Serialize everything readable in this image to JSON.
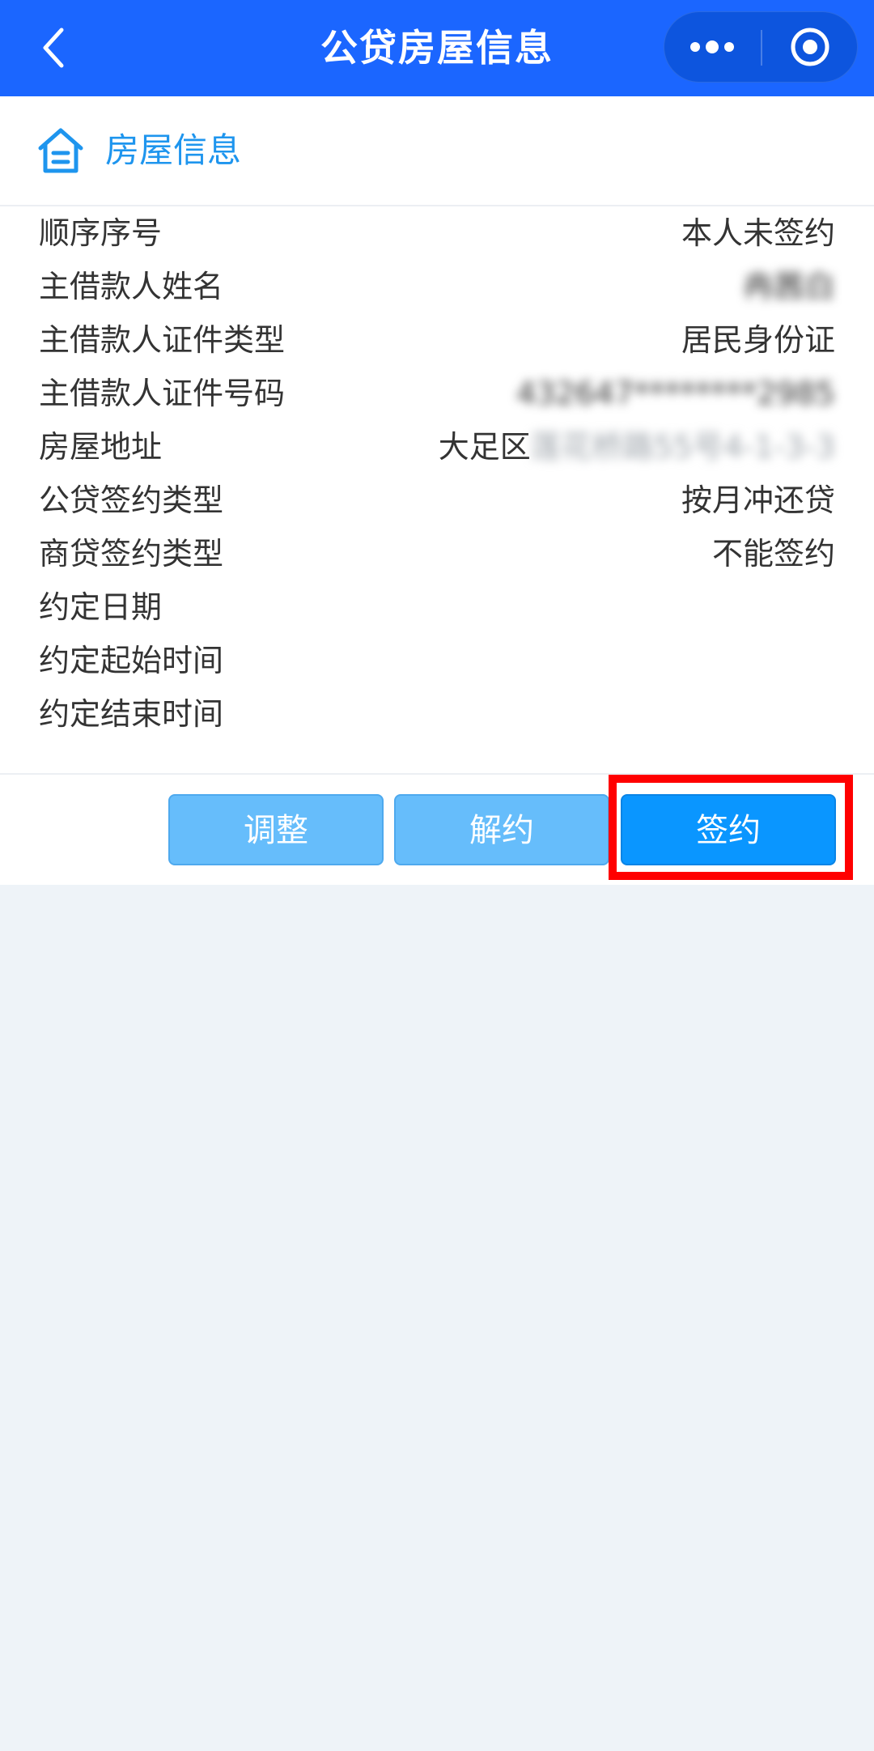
{
  "header": {
    "title": "公贷房屋信息",
    "back_icon": "chevron-left-icon",
    "more_icon": "more-dots-icon",
    "target_icon": "target-icon"
  },
  "section": {
    "icon": "house-icon",
    "title": "房屋信息",
    "accent_color": "#1e95ee"
  },
  "info_rows": [
    {
      "label": "顺序序号",
      "value": "本人未签约"
    },
    {
      "label": "主借款人姓名",
      "value": "冉茜白"
    },
    {
      "label": "主借款人证件类型",
      "value": "居民身份证"
    },
    {
      "label": "主借款人证件号码",
      "value": "432647********2985"
    },
    {
      "label": "房屋地址",
      "value_prefix": "大足区",
      "value": "莲花桥路55号4-1-3-3"
    },
    {
      "label": "公贷签约类型",
      "value": "按月冲还贷"
    },
    {
      "label": "商贷签约类型",
      "value": "不能签约"
    },
    {
      "label": "约定日期",
      "value": ""
    },
    {
      "label": "约定起始时间",
      "value": ""
    },
    {
      "label": "约定结束时间",
      "value": ""
    }
  ],
  "buttons": {
    "adjust": "调整",
    "cancel_contract": "解约",
    "sign": "签约"
  },
  "colors": {
    "header_bg": "#1b66ff",
    "page_bg": "#eef3f8",
    "button_light": "#66bdfb",
    "button_primary": "#0a96ff",
    "highlight": "#ff0000"
  }
}
